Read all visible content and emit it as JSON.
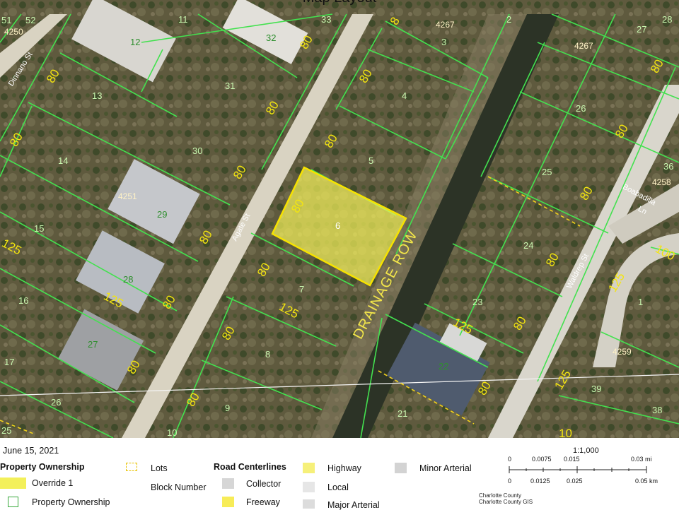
{
  "title": "Map Layout",
  "map": {
    "street_labels": [
      "Dinnano St",
      "Agate St",
      "Waldrep St",
      "Boabadilla",
      "Ln"
    ],
    "drainage_label": "DRAINAGE ROW",
    "selected_parcel": "6",
    "block_numbers": [
      "4250",
      "4267",
      "4267",
      "4251",
      "4258",
      "4259"
    ],
    "lot_numbers": [
      "51",
      "52",
      "11",
      "33",
      "12",
      "32",
      "3",
      "2",
      "27",
      "28",
      "13",
      "31",
      "4",
      "26",
      "14",
      "30",
      "5",
      "25",
      "36",
      "29",
      "15",
      "6",
      "24",
      "28",
      "7",
      "16",
      "23",
      "1",
      "27",
      "8",
      "22",
      "17",
      "26",
      "9",
      "21",
      "39",
      "38",
      "25",
      "10"
    ],
    "dimensions": [
      "80",
      "80",
      "80",
      "80",
      "80",
      "80",
      "80",
      "80",
      "80",
      "80",
      "80",
      "80",
      "80",
      "80",
      "80",
      "80",
      "80",
      "80",
      "80",
      "80",
      "125",
      "125",
      "125",
      "125",
      "125",
      "125",
      "100",
      "10",
      "8"
    ]
  },
  "legend": {
    "date": "June 15, 2021",
    "property_ownership_heading": "Property Ownership",
    "override_label": "Override 1",
    "ownership_label": "Property Ownership",
    "lots_label": "Lots",
    "block_number_label": "Block Number",
    "road_heading": "Road Centerlines",
    "collector_label": "Collector",
    "freeway_label": "Freeway",
    "highway_label": "Highway",
    "local_label": "Local",
    "major_arterial_label": "Major Arterial",
    "minor_arterial_label": "Minor Arterial",
    "scale_ratio": "1:1,000",
    "scale_mi": [
      "0",
      "0.0075",
      "0.015",
      "0.03 mi"
    ],
    "scale_km": [
      "0",
      "0.0125",
      "0.025",
      "0.05 km"
    ],
    "credit_1": "Charlotte County",
    "credit_2": "Charlotte County GIS",
    "colors": {
      "override": "#f3f05a",
      "ownership_outline": "#37a83a",
      "lots": "#e8c200",
      "highway": "#f6f07a",
      "freeway": "#f7ec58",
      "collector": "#d6d6d6",
      "local": "#e6e6e6",
      "major_arterial": "#dcdcdc",
      "minor_arterial": "#d3d3d3"
    }
  }
}
